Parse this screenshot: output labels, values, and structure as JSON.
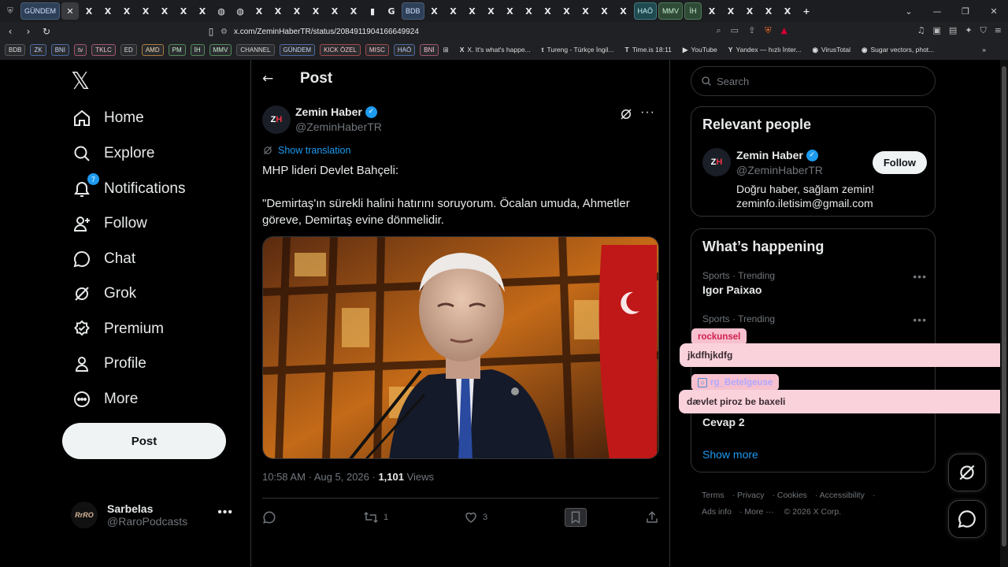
{
  "browser": {
    "tabs": [
      {
        "label": "GÜNDEM",
        "type": "label"
      },
      {
        "label": "✕",
        "type": "x-active"
      },
      {
        "label": "X",
        "type": "x"
      },
      {
        "label": "X",
        "type": "x"
      },
      {
        "label": "X",
        "type": "x"
      },
      {
        "label": "X",
        "type": "x"
      },
      {
        "label": "X",
        "type": "x"
      },
      {
        "label": "X",
        "type": "x"
      },
      {
        "label": "X",
        "type": "x"
      },
      {
        "label": "◍",
        "type": "x"
      },
      {
        "label": "◍",
        "type": "x"
      },
      {
        "label": "X",
        "type": "x"
      },
      {
        "label": "X",
        "type": "x"
      },
      {
        "label": "X",
        "type": "x"
      },
      {
        "label": "X",
        "type": "x"
      },
      {
        "label": "X",
        "type": "x"
      },
      {
        "label": "X",
        "type": "x"
      },
      {
        "label": "▮",
        "type": "x"
      },
      {
        "label": "G",
        "type": "x"
      },
      {
        "label": "BDB",
        "type": "label"
      },
      {
        "label": "X",
        "type": "x"
      },
      {
        "label": "X",
        "type": "x"
      },
      {
        "label": "X",
        "type": "x"
      },
      {
        "label": "X",
        "type": "x"
      },
      {
        "label": "X",
        "type": "x"
      },
      {
        "label": "X",
        "type": "x"
      },
      {
        "label": "X",
        "type": "x"
      },
      {
        "label": "X",
        "type": "x"
      },
      {
        "label": "X",
        "type": "x"
      },
      {
        "label": "X",
        "type": "x"
      },
      {
        "label": "X",
        "type": "x"
      },
      {
        "label": "HAÖ",
        "type": "teal"
      },
      {
        "label": "MMV",
        "type": "green"
      },
      {
        "label": "İH",
        "type": "green"
      },
      {
        "label": "X",
        "type": "x"
      },
      {
        "label": "X",
        "type": "x"
      },
      {
        "label": "X",
        "type": "x"
      },
      {
        "label": "X",
        "type": "x"
      },
      {
        "label": "X",
        "type": "x"
      },
      {
        "label": "+",
        "type": "x"
      }
    ],
    "url": "x.com/ZeminHaberTR/status/2084911904166649924",
    "bookmarks_labels": [
      {
        "label": "BDB",
        "c": ""
      },
      {
        "label": "ZK",
        "c": "blue"
      },
      {
        "label": "BNI",
        "c": "blue"
      },
      {
        "label": "tv",
        "c": "pink"
      },
      {
        "label": "TKLC",
        "c": "pink"
      },
      {
        "label": "ED",
        "c": ""
      },
      {
        "label": "AMD",
        "c": "orange"
      },
      {
        "label": "PM",
        "c": "green"
      },
      {
        "label": "İH",
        "c": "green"
      },
      {
        "label": "MMV",
        "c": "green"
      },
      {
        "label": "CHANNEL",
        "c": ""
      },
      {
        "label": "GÜNDEM",
        "c": "blue"
      },
      {
        "label": "KICK ÖZEL",
        "c": "red"
      },
      {
        "label": "MISC",
        "c": "red"
      },
      {
        "label": "HAÖ",
        "c": "blue"
      },
      {
        "label": "BNİ",
        "c": "pink"
      }
    ],
    "bookmarks_sites": [
      {
        "icon": "X",
        "label": "X. It's what's happe..."
      },
      {
        "icon": "t",
        "label": "Tureng - Türkçe İngil..."
      },
      {
        "icon": "T",
        "label": "Time.is 18:11"
      },
      {
        "icon": "▶",
        "label": "YouTube"
      },
      {
        "icon": "Y",
        "label": "Yandex — hızlı İnter..."
      },
      {
        "icon": "◉",
        "label": "VirusTotal"
      },
      {
        "icon": "◉",
        "label": "Sugar vectors, phot..."
      }
    ]
  },
  "sidebar": {
    "logo": "𝕏",
    "items": [
      {
        "label": "Home",
        "icon": "home-icon"
      },
      {
        "label": "Explore",
        "icon": "search-icon"
      },
      {
        "label": "Notifications",
        "icon": "bell-icon",
        "badge": "7"
      },
      {
        "label": "Follow",
        "icon": "follow-icon"
      },
      {
        "label": "Chat",
        "icon": "chat-icon"
      },
      {
        "label": "Grok",
        "icon": "grok-icon"
      },
      {
        "label": "Premium",
        "icon": "premium-icon"
      },
      {
        "label": "Profile",
        "icon": "profile-icon"
      },
      {
        "label": "More",
        "icon": "more-icon"
      }
    ],
    "post_label": "Post",
    "account": {
      "name": "Sarbelas",
      "handle": "@RaroPodcasts",
      "avatar_text": "RrRO"
    }
  },
  "main": {
    "title": "Post",
    "author": {
      "name": "Zemin Haber",
      "handle": "@ZeminHaberTR",
      "avatar": "ZH"
    },
    "show_translation": "Show translation",
    "text_lines": [
      "MHP lideri Devlet Bahçeli:",
      "\"Demirtaş'ın sürekli halini hatırını soruyorum. Öcalan umuda, Ahmetler göreve, Demirtaş evine dönmelidir."
    ],
    "time": "10:58 AM · Aug 5, 2026 · ",
    "views_count": "1,101",
    "views_label": " Views",
    "retweets": "1",
    "likes": "3"
  },
  "right": {
    "search_placeholder": "Search",
    "relevant_title": "Relevant people",
    "person": {
      "name": "Zemin Haber",
      "handle": "@ZeminHaberTR",
      "avatar": "ZH",
      "follow": "Follow",
      "bio1": "Doğru haber, sağlam zemin!",
      "bio2": "zeminfo.iletisim@gmail.com"
    },
    "happening_title": "What’s happening",
    "trends": [
      {
        "category": "Sports · Trending",
        "title": "Igor Paixao"
      },
      {
        "category": "Sports · Trending",
        "title": ""
      },
      {
        "category": "",
        "title": "Cevap 2"
      }
    ],
    "show_more": "Show more",
    "footer": [
      "Terms",
      "Privacy",
      "Cookies",
      "Accessibility",
      "Ads info",
      "More ···",
      "© 2026 X Corp."
    ]
  },
  "chat_overlay": [
    {
      "user": "rockunsel",
      "message": "jkdfhjkdfg",
      "user_color": "#d0204a"
    },
    {
      "user": "rg_Betelgeuse",
      "message": "dævlet piroz be baxeli",
      "user_color": "#b0a8ff"
    }
  ],
  "colors": {
    "accent": "#1d9bf0",
    "bg": "#000000",
    "muted": "#71767b"
  }
}
